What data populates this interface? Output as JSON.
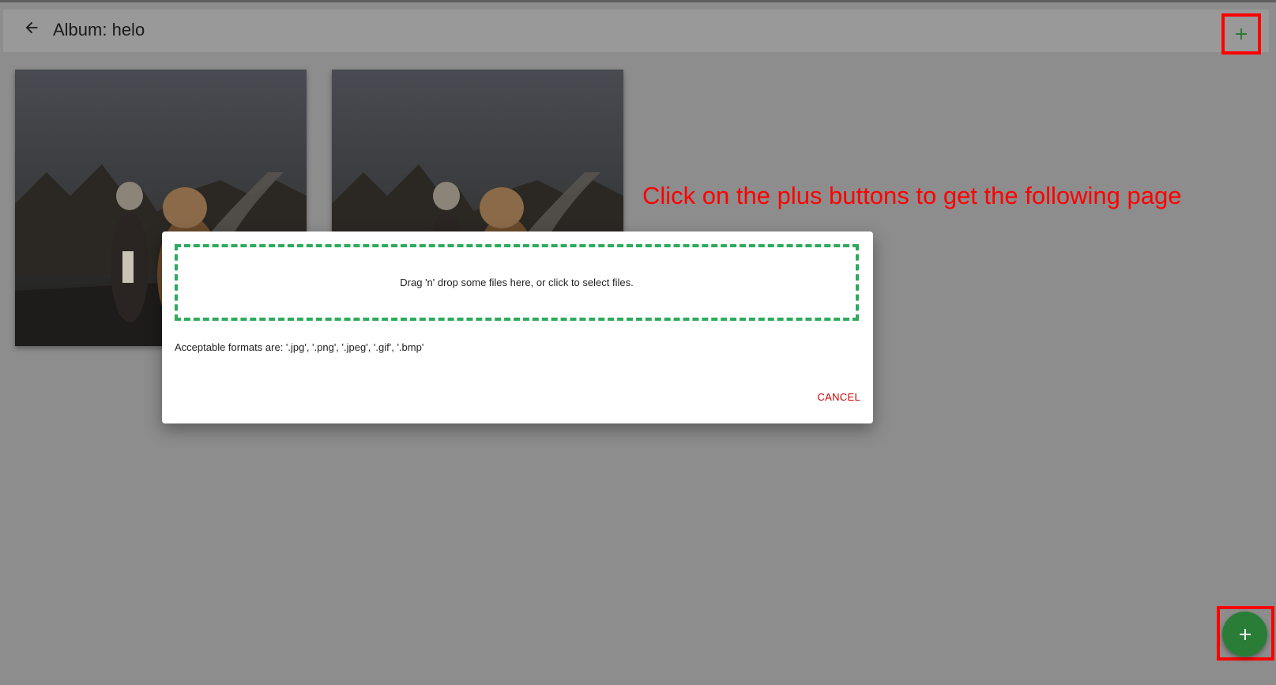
{
  "appbar": {
    "title": "Album: helo",
    "back_icon": "arrow-left-icon",
    "add_icon": "plus-icon"
  },
  "photos": [
    {
      "name": "photo-child-and-dog-1"
    },
    {
      "name": "photo-child-and-dog-2"
    }
  ],
  "annotation": {
    "text": "Click on the plus buttons to get the following page",
    "color": "#ff0000"
  },
  "dialog": {
    "dropzone_text": "Drag 'n' drop some files here, or click to select files.",
    "formats_text": "Acceptable formats are: '.jpg', '.png', '.jpeg', '.gif', '.bmp'",
    "cancel_label": "CANCEL",
    "dropzone_border_color": "#2eaa5c",
    "cancel_color": "#cc0000"
  },
  "fab": {
    "icon": "plus-icon",
    "color": "#2a7d37"
  },
  "colors": {
    "overlay_background": "#8d8d8d",
    "appbar_background": "#999999",
    "highlight_box": "#ff0000",
    "accent_green": "#2a7d37"
  }
}
